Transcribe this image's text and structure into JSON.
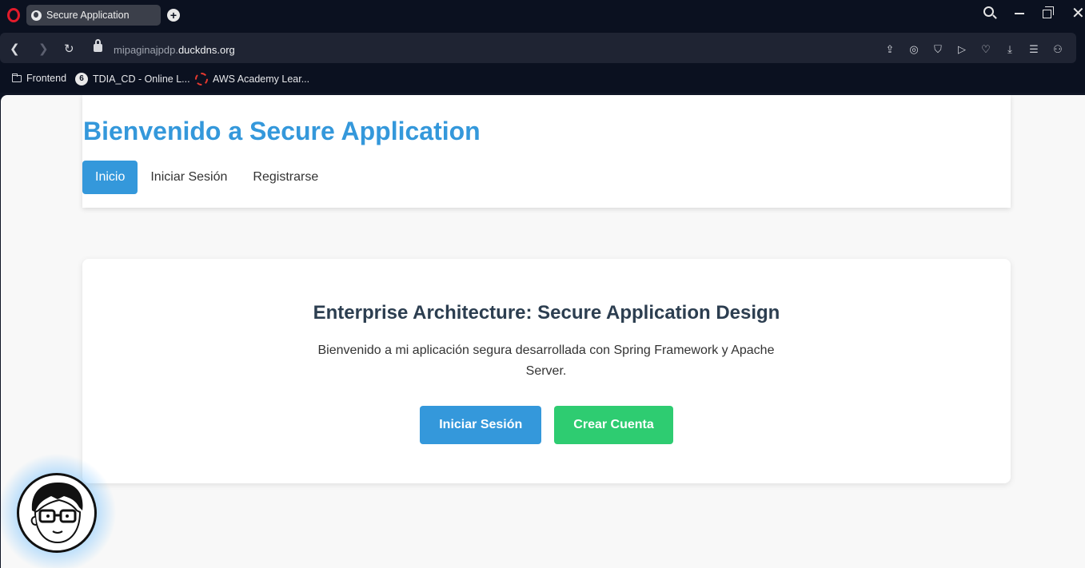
{
  "browser": {
    "tab_title": "Secure Application",
    "url_prefix": "mipaginajpdp.",
    "url_domain": "duckdns.org",
    "bookmarks": [
      {
        "label": "Frontend",
        "icon": "folder-icon"
      },
      {
        "label": "TDIA_CD - Online L...",
        "icon": "tdia-icon"
      },
      {
        "label": "AWS Academy Lear...",
        "icon": "aws-icon"
      }
    ],
    "tdia_glyph": "6"
  },
  "page": {
    "title": "Bienvenido a Secure Application",
    "nav": [
      {
        "label": "Inicio",
        "active": true
      },
      {
        "label": "Iniciar Sesión",
        "active": false
      },
      {
        "label": "Registrarse",
        "active": false
      }
    ],
    "hero": {
      "title": "Enterprise Architecture: Secure Application Design",
      "description": "Bienvenido a mi aplicación segura desarrollada con Spring Framework y Apache Server.",
      "login_button": "Iniciar Sesión",
      "signup_button": "Crear Cuenta"
    }
  },
  "colors": {
    "primary": "#3498db",
    "success": "#2ecc71",
    "heading": "#2c3e50"
  }
}
